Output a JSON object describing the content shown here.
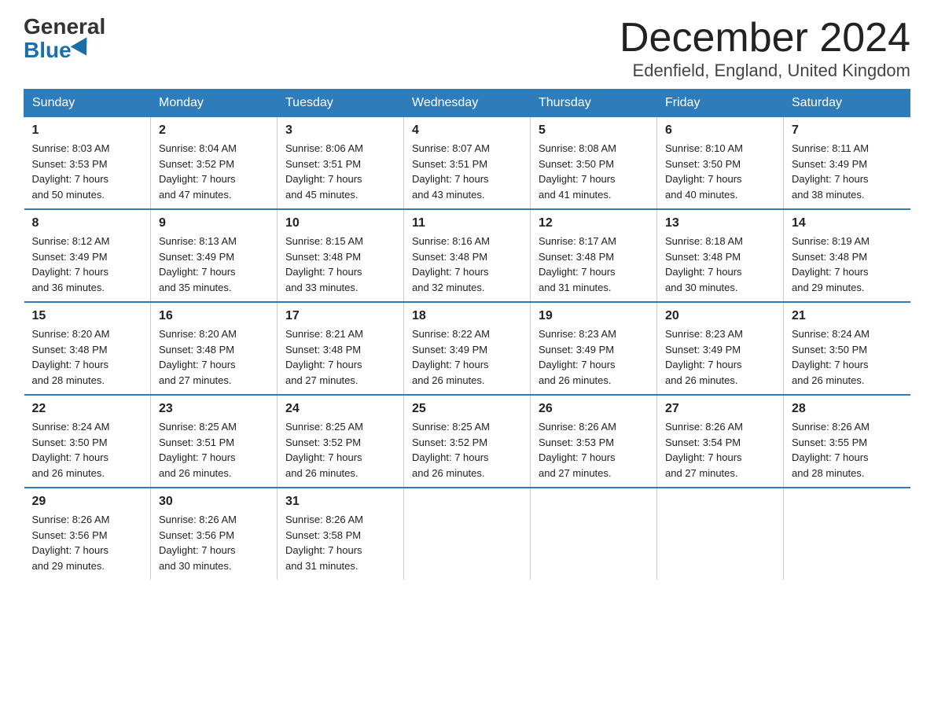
{
  "logo": {
    "general": "General",
    "blue": "Blue"
  },
  "title": "December 2024",
  "location": "Edenfield, England, United Kingdom",
  "days_of_week": [
    "Sunday",
    "Monday",
    "Tuesday",
    "Wednesday",
    "Thursday",
    "Friday",
    "Saturday"
  ],
  "weeks": [
    [
      {
        "day": "1",
        "info": "Sunrise: 8:03 AM\nSunset: 3:53 PM\nDaylight: 7 hours\nand 50 minutes."
      },
      {
        "day": "2",
        "info": "Sunrise: 8:04 AM\nSunset: 3:52 PM\nDaylight: 7 hours\nand 47 minutes."
      },
      {
        "day": "3",
        "info": "Sunrise: 8:06 AM\nSunset: 3:51 PM\nDaylight: 7 hours\nand 45 minutes."
      },
      {
        "day": "4",
        "info": "Sunrise: 8:07 AM\nSunset: 3:51 PM\nDaylight: 7 hours\nand 43 minutes."
      },
      {
        "day": "5",
        "info": "Sunrise: 8:08 AM\nSunset: 3:50 PM\nDaylight: 7 hours\nand 41 minutes."
      },
      {
        "day": "6",
        "info": "Sunrise: 8:10 AM\nSunset: 3:50 PM\nDaylight: 7 hours\nand 40 minutes."
      },
      {
        "day": "7",
        "info": "Sunrise: 8:11 AM\nSunset: 3:49 PM\nDaylight: 7 hours\nand 38 minutes."
      }
    ],
    [
      {
        "day": "8",
        "info": "Sunrise: 8:12 AM\nSunset: 3:49 PM\nDaylight: 7 hours\nand 36 minutes."
      },
      {
        "day": "9",
        "info": "Sunrise: 8:13 AM\nSunset: 3:49 PM\nDaylight: 7 hours\nand 35 minutes."
      },
      {
        "day": "10",
        "info": "Sunrise: 8:15 AM\nSunset: 3:48 PM\nDaylight: 7 hours\nand 33 minutes."
      },
      {
        "day": "11",
        "info": "Sunrise: 8:16 AM\nSunset: 3:48 PM\nDaylight: 7 hours\nand 32 minutes."
      },
      {
        "day": "12",
        "info": "Sunrise: 8:17 AM\nSunset: 3:48 PM\nDaylight: 7 hours\nand 31 minutes."
      },
      {
        "day": "13",
        "info": "Sunrise: 8:18 AM\nSunset: 3:48 PM\nDaylight: 7 hours\nand 30 minutes."
      },
      {
        "day": "14",
        "info": "Sunrise: 8:19 AM\nSunset: 3:48 PM\nDaylight: 7 hours\nand 29 minutes."
      }
    ],
    [
      {
        "day": "15",
        "info": "Sunrise: 8:20 AM\nSunset: 3:48 PM\nDaylight: 7 hours\nand 28 minutes."
      },
      {
        "day": "16",
        "info": "Sunrise: 8:20 AM\nSunset: 3:48 PM\nDaylight: 7 hours\nand 27 minutes."
      },
      {
        "day": "17",
        "info": "Sunrise: 8:21 AM\nSunset: 3:48 PM\nDaylight: 7 hours\nand 27 minutes."
      },
      {
        "day": "18",
        "info": "Sunrise: 8:22 AM\nSunset: 3:49 PM\nDaylight: 7 hours\nand 26 minutes."
      },
      {
        "day": "19",
        "info": "Sunrise: 8:23 AM\nSunset: 3:49 PM\nDaylight: 7 hours\nand 26 minutes."
      },
      {
        "day": "20",
        "info": "Sunrise: 8:23 AM\nSunset: 3:49 PM\nDaylight: 7 hours\nand 26 minutes."
      },
      {
        "day": "21",
        "info": "Sunrise: 8:24 AM\nSunset: 3:50 PM\nDaylight: 7 hours\nand 26 minutes."
      }
    ],
    [
      {
        "day": "22",
        "info": "Sunrise: 8:24 AM\nSunset: 3:50 PM\nDaylight: 7 hours\nand 26 minutes."
      },
      {
        "day": "23",
        "info": "Sunrise: 8:25 AM\nSunset: 3:51 PM\nDaylight: 7 hours\nand 26 minutes."
      },
      {
        "day": "24",
        "info": "Sunrise: 8:25 AM\nSunset: 3:52 PM\nDaylight: 7 hours\nand 26 minutes."
      },
      {
        "day": "25",
        "info": "Sunrise: 8:25 AM\nSunset: 3:52 PM\nDaylight: 7 hours\nand 26 minutes."
      },
      {
        "day": "26",
        "info": "Sunrise: 8:26 AM\nSunset: 3:53 PM\nDaylight: 7 hours\nand 27 minutes."
      },
      {
        "day": "27",
        "info": "Sunrise: 8:26 AM\nSunset: 3:54 PM\nDaylight: 7 hours\nand 27 minutes."
      },
      {
        "day": "28",
        "info": "Sunrise: 8:26 AM\nSunset: 3:55 PM\nDaylight: 7 hours\nand 28 minutes."
      }
    ],
    [
      {
        "day": "29",
        "info": "Sunrise: 8:26 AM\nSunset: 3:56 PM\nDaylight: 7 hours\nand 29 minutes."
      },
      {
        "day": "30",
        "info": "Sunrise: 8:26 AM\nSunset: 3:56 PM\nDaylight: 7 hours\nand 30 minutes."
      },
      {
        "day": "31",
        "info": "Sunrise: 8:26 AM\nSunset: 3:58 PM\nDaylight: 7 hours\nand 31 minutes."
      },
      {
        "day": "",
        "info": ""
      },
      {
        "day": "",
        "info": ""
      },
      {
        "day": "",
        "info": ""
      },
      {
        "day": "",
        "info": ""
      }
    ]
  ]
}
